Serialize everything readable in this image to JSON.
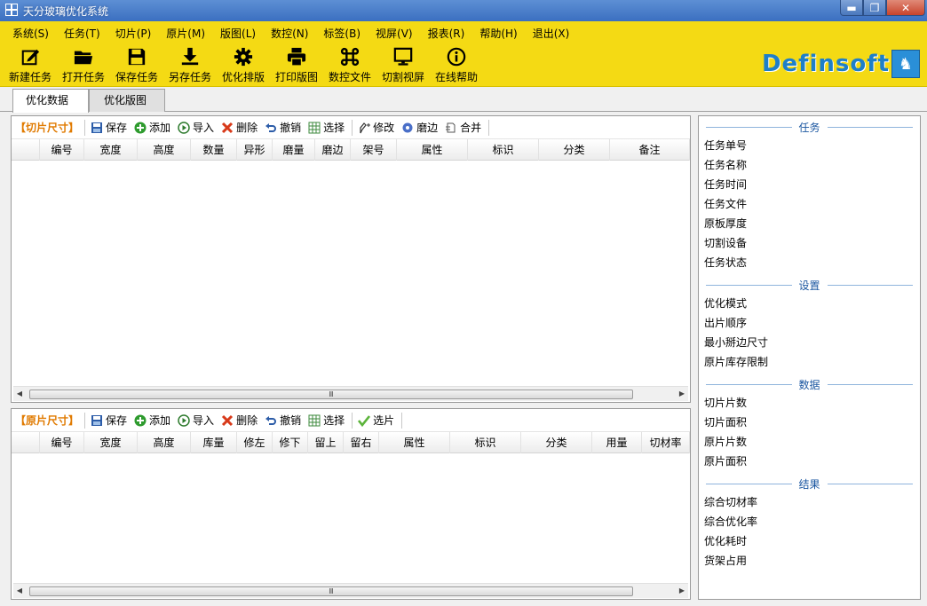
{
  "window": {
    "title": "天分玻璃优化系统",
    "buttons": {
      "minimize": "▬",
      "maximize": "❐",
      "close": "✕"
    }
  },
  "menu": [
    "系统(S)",
    "任务(T)",
    "切片(P)",
    "原片(M)",
    "版图(L)",
    "数控(N)",
    "标签(B)",
    "视屏(V)",
    "报表(R)",
    "帮助(H)",
    "退出(X)"
  ],
  "toolbar": [
    {
      "label": "新建任务",
      "icon": "new-task-icon"
    },
    {
      "label": "打开任务",
      "icon": "open-folder-icon"
    },
    {
      "label": "保存任务",
      "icon": "save-icon"
    },
    {
      "label": "另存任务",
      "icon": "download-icon"
    },
    {
      "label": "优化排版",
      "icon": "gear-icon"
    },
    {
      "label": "打印版图",
      "icon": "printer-icon"
    },
    {
      "label": "数控文件",
      "icon": "command-icon"
    },
    {
      "label": "切割视屏",
      "icon": "monitor-icon"
    },
    {
      "label": "在线帮助",
      "icon": "info-icon"
    }
  ],
  "brand": {
    "name": "Definsoft"
  },
  "tabs": [
    "优化数据",
    "优化版图"
  ],
  "cut_panel": {
    "title": "【切片尺寸】",
    "buttons": [
      "保存",
      "添加",
      "导入",
      "删除",
      "撤销",
      "选择",
      "修改",
      "磨边",
      "合并"
    ],
    "columns": [
      "编号",
      "宽度",
      "高度",
      "数量",
      "异形",
      "磨量",
      "磨边",
      "架号",
      "属性",
      "标识",
      "分类",
      "备注"
    ],
    "scroll_grip": "Ⅲ"
  },
  "sheet_panel": {
    "title": "【原片尺寸】",
    "buttons": [
      "保存",
      "添加",
      "导入",
      "删除",
      "撤销",
      "选择",
      "选片"
    ],
    "columns": [
      "编号",
      "宽度",
      "高度",
      "库量",
      "修左",
      "修下",
      "留上",
      "留右",
      "属性",
      "标识",
      "分类",
      "用量",
      "切材率"
    ],
    "scroll_grip": "Ⅲ"
  },
  "side": [
    {
      "title": "任务",
      "items": [
        "任务单号",
        "任务名称",
        "任务时间",
        "任务文件",
        "原板厚度",
        "切割设备",
        "任务状态"
      ]
    },
    {
      "title": "设置",
      "items": [
        "优化模式",
        "出片顺序",
        "最小掰边尺寸",
        "原片库存限制"
      ]
    },
    {
      "title": "数据",
      "items": [
        "切片片数",
        "切片面积",
        "原片片数",
        "原片面积"
      ]
    },
    {
      "title": "结果",
      "items": [
        "综合切材率",
        "综合优化率",
        "优化耗时",
        "货架占用"
      ]
    }
  ],
  "colors": {
    "toolbar_bg": "#f4da14",
    "panel_title": "#e07a00",
    "section_title": "#1a56a0",
    "brand": "#1e7fc8"
  }
}
